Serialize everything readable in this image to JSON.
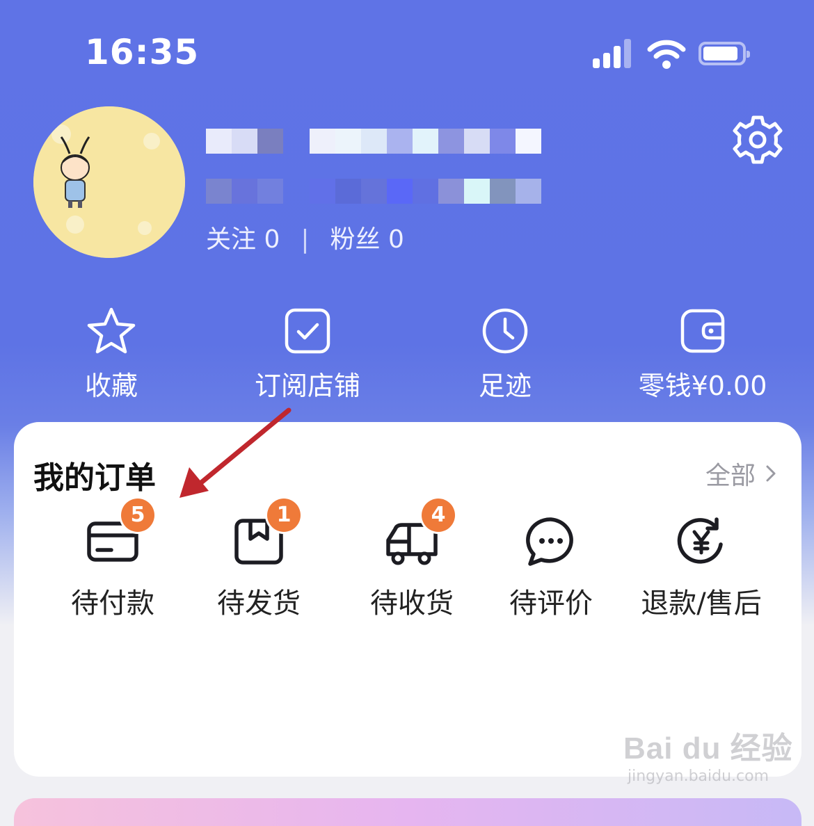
{
  "status_bar": {
    "time": "16:35"
  },
  "profile": {
    "follow_label": "关注",
    "follow_count": "0",
    "fans_label": "粉丝",
    "fans_count": "0",
    "name_mosaic_colors": [
      "#e9ebfb",
      "#d8dcf6",
      "#7a7fbf",
      "#eef0fb",
      "#ecf4fb",
      "#dde8f8",
      "#aab3ef",
      "#e2f3fb",
      "#8d94e0",
      "#d7dcf5",
      "#7e88e8",
      "#f4f6ff"
    ],
    "id_mosaic_colors": [
      "#7a84cf",
      "#6873dc",
      "#7280de",
      "#6170e8",
      "#5b6bd8",
      "#6573da",
      "#5a68f7",
      "#6070e2",
      "#8b91d9",
      "#d9f6f8",
      "#8294bd",
      "#a6b2ea"
    ]
  },
  "icons": {
    "settings": "gear-icon"
  },
  "quick_actions": [
    {
      "label": "收藏",
      "icon": "star-icon"
    },
    {
      "label": "订阅店铺",
      "icon": "check-square-icon"
    },
    {
      "label": "足迹",
      "icon": "clock-icon"
    },
    {
      "label": "零钱¥0.00",
      "icon": "wallet-icon"
    }
  ],
  "orders": {
    "title": "我的订单",
    "view_all": "全部",
    "items": [
      {
        "label": "待付款",
        "badge": "5",
        "icon": "card-icon"
      },
      {
        "label": "待发货",
        "badge": "1",
        "icon": "box-icon"
      },
      {
        "label": "待收货",
        "badge": "4",
        "icon": "truck-icon"
      },
      {
        "label": "待评价",
        "badge": "",
        "icon": "chat-icon"
      },
      {
        "label": "退款/售后",
        "badge": "",
        "icon": "refund-yen-icon"
      }
    ]
  },
  "watermark": {
    "main": "Bai du 经验",
    "sub": "jingyan.baidu.com"
  },
  "colors": {
    "header_blue": "#5f73e6",
    "badge_orange": "#ef7a39",
    "annotation_red": "#c0272d"
  }
}
